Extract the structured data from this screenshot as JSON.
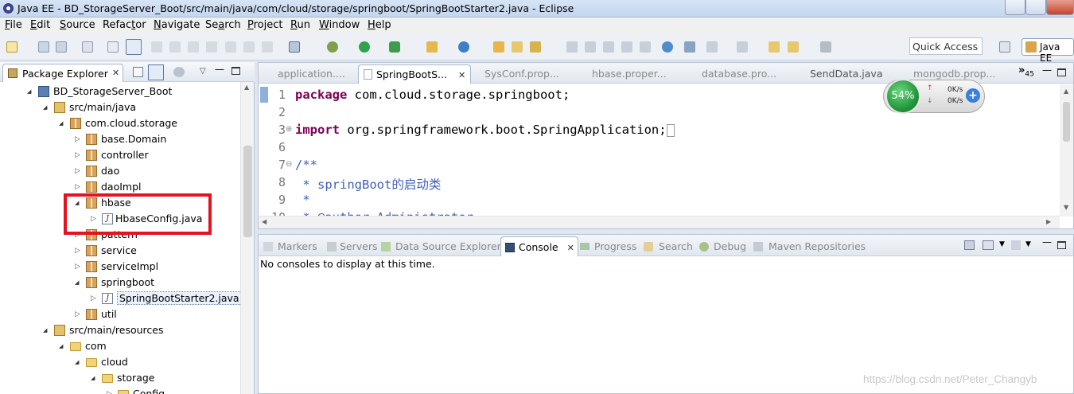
{
  "window": {
    "title": "Java EE - BD_StorageServer_Boot/src/main/java/com/cloud/storage/springboot/SpringBootStarter2.java - Eclipse"
  },
  "menu": [
    {
      "label": "File",
      "mnemonic": "F",
      "rest": "ile"
    },
    {
      "label": "Edit",
      "mnemonic": "E",
      "rest": "dit"
    },
    {
      "label": "Source",
      "mnemonic": "S",
      "rest": "ource"
    },
    {
      "label": "Refactor",
      "mnemonic": "t",
      "pre": "Refac",
      "rest": "or"
    },
    {
      "label": "Navigate",
      "mnemonic": "N",
      "rest": "avigate"
    },
    {
      "label": "Search",
      "mnemonic": "a",
      "pre": "Se",
      "rest": "rch"
    },
    {
      "label": "Project",
      "mnemonic": "P",
      "rest": "roject"
    },
    {
      "label": "Run",
      "mnemonic": "R",
      "rest": "un"
    },
    {
      "label": "Window",
      "mnemonic": "W",
      "rest": "indow"
    },
    {
      "label": "Help",
      "mnemonic": "H",
      "rest": "elp"
    }
  ],
  "toolbar": {
    "quick_access": "Quick Access",
    "perspective": "Java EE"
  },
  "package_explorer": {
    "tab_label": "Package Explorer",
    "tree": [
      {
        "label": "BD_StorageServer_Boot",
        "icon": "project-icon",
        "twist": "▾"
      },
      {
        "label": "src/main/java",
        "icon": "source-folder-icon",
        "twist": "▾"
      },
      {
        "label": "com.cloud.storage",
        "icon": "package-icon",
        "twist": "▾"
      },
      {
        "label": "base.Domain",
        "icon": "package-icon",
        "twist": "▷"
      },
      {
        "label": "controller",
        "icon": "package-icon",
        "twist": "▷"
      },
      {
        "label": "dao",
        "icon": "package-icon",
        "twist": "▷"
      },
      {
        "label": "daoImpl",
        "icon": "package-icon",
        "twist": "▷"
      },
      {
        "label": "hbase",
        "icon": "package-icon",
        "twist": "▾"
      },
      {
        "label": "HbaseConfig.java",
        "icon": "java-file-icon",
        "twist": "▷"
      },
      {
        "label": "pattern",
        "icon": "package-icon",
        "twist": "▷"
      },
      {
        "label": "service",
        "icon": "package-icon",
        "twist": "▷"
      },
      {
        "label": "serviceImpl",
        "icon": "package-icon",
        "twist": "▷"
      },
      {
        "label": "springboot",
        "icon": "package-icon",
        "twist": "▾"
      },
      {
        "label": "SpringBootStarter2.java",
        "icon": "java-file-icon",
        "twist": "▷"
      },
      {
        "label": "util",
        "icon": "package-icon",
        "twist": "▷"
      },
      {
        "label": "src/main/resources",
        "icon": "source-folder-icon",
        "twist": "▾"
      },
      {
        "label": "com",
        "icon": "folder-icon",
        "twist": "▾"
      },
      {
        "label": "cloud",
        "icon": "folder-icon",
        "twist": "▾"
      },
      {
        "label": "storage",
        "icon": "folder-icon",
        "twist": "▾"
      },
      {
        "label": "Config",
        "icon": "folder-icon",
        "twist": "▷"
      }
    ]
  },
  "editor": {
    "tabs": [
      {
        "label": "application...."
      },
      {
        "label": "SpringBootS..."
      },
      {
        "label": "SysConf.prop..."
      },
      {
        "label": "hbase.proper..."
      },
      {
        "label": "database.pro..."
      },
      {
        "label": "SendData.java"
      },
      {
        "label": "mongodb.prop..."
      }
    ],
    "overflow_count": "45",
    "lines": [
      {
        "num": "1",
        "kw": "package",
        "text": " com.cloud.storage.springboot;"
      },
      {
        "num": "2",
        "kw": "",
        "text": ""
      },
      {
        "num": "3",
        "kw": "import",
        "text": " org.springframework.boot.SpringApplication;"
      },
      {
        "num": "6",
        "kw": "",
        "text": ""
      },
      {
        "num": "7",
        "comment": "/**"
      },
      {
        "num": "8",
        "comment": " * springBoot的启动类"
      },
      {
        "num": "9",
        "comment": " *"
      },
      {
        "num": "10",
        "comment": " * @author Administrator"
      }
    ]
  },
  "net_widget": {
    "percent": "54%",
    "up_rate": "0K/s",
    "down_rate": "0K/s",
    "plus": "+"
  },
  "console_panel": {
    "tabs": [
      {
        "label": "Markers"
      },
      {
        "label": "Servers"
      },
      {
        "label": "Data Source Explorer"
      },
      {
        "label": "Console"
      },
      {
        "label": "Progress"
      },
      {
        "label": "Search"
      },
      {
        "label": "Debug"
      },
      {
        "label": "Maven Repositories"
      }
    ],
    "message": "No consoles to display at this time."
  },
  "watermark": "https://blog.csdn.net/Peter_Changyb",
  "colors": {
    "highlight_box": "#e4131f",
    "keyword": "#7f0055",
    "comment": "#3f5fbf",
    "net_green": "#1b8f35"
  }
}
